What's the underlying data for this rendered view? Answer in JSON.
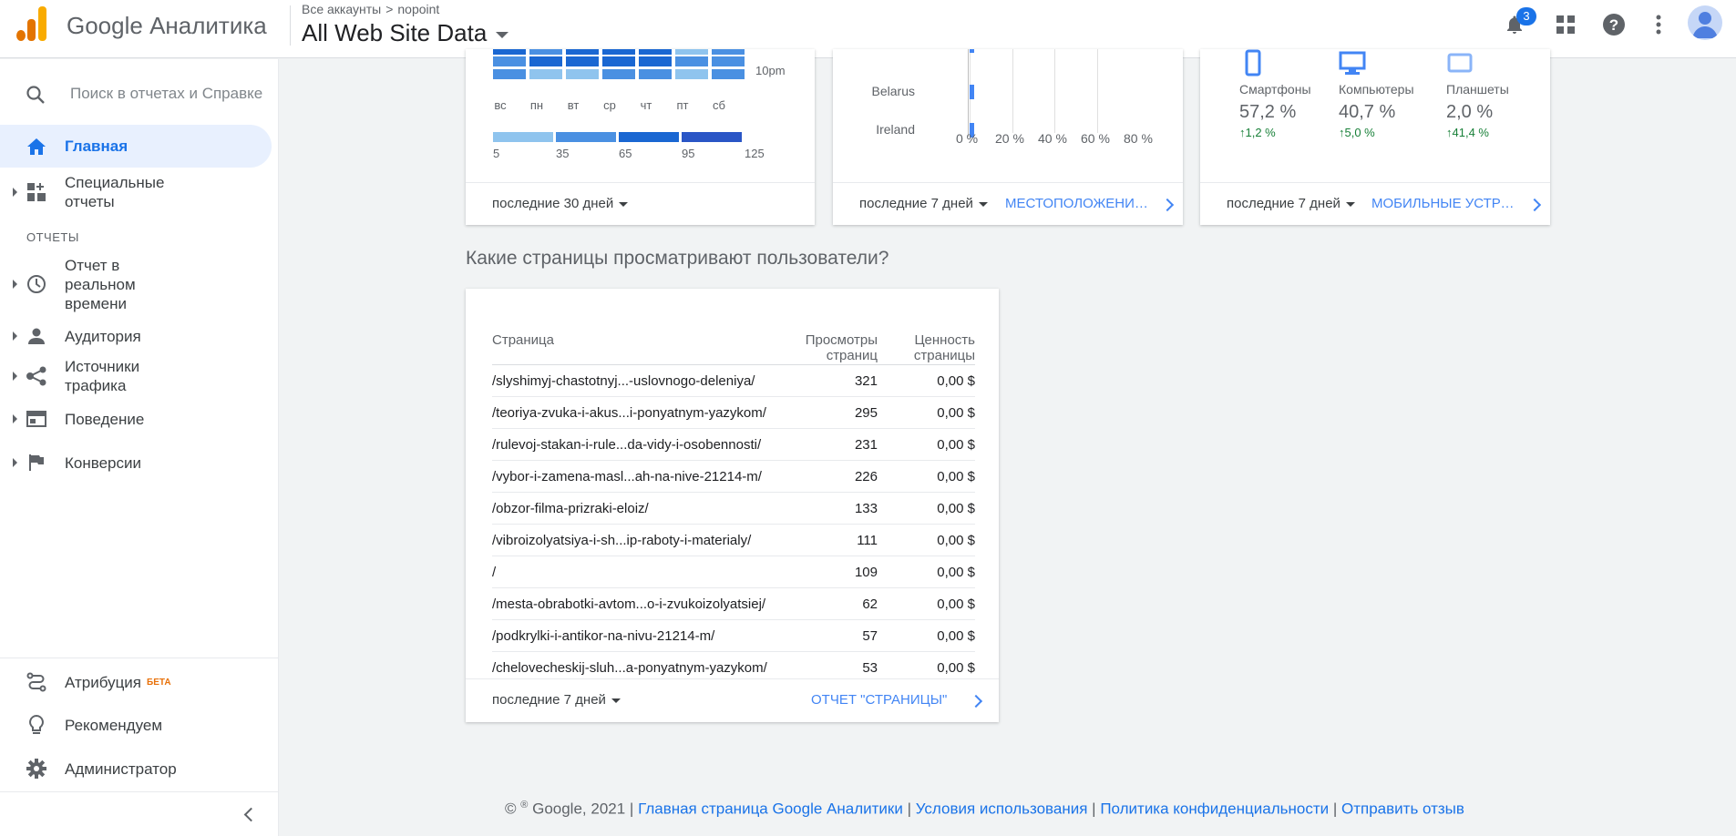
{
  "header": {
    "app_name": "Google Аналитика",
    "breadcrumb_accounts": "Все аккаунты",
    "breadcrumb_sep": ">",
    "breadcrumb_account": "nopoint",
    "property": "All Web Site Data",
    "notification_count": "3",
    "icons": [
      "bell-icon",
      "apps-icon",
      "help-icon",
      "more-vert-icon",
      "avatar"
    ]
  },
  "sidebar": {
    "search_placeholder": "Поиск в отчетах и Справке",
    "home": "Главная",
    "custom_reports_1": "Специальные",
    "custom_reports_2": "отчеты",
    "section_reports": "ОТЧЕТЫ",
    "realtime_1": "Отчет в",
    "realtime_2": "реальном",
    "realtime_3": "времени",
    "audience": "Аудитория",
    "acquisition_1": "Источники",
    "acquisition_2": "трафика",
    "behavior": "Поведение",
    "conversions": "Конверсии",
    "attribution": "Атрибуция",
    "attribution_badge": "БЕТА",
    "discover": "Рекомендуем",
    "admin": "Администратор"
  },
  "heatmap_card": {
    "time_label": "10pm",
    "days": [
      "вс",
      "пн",
      "вт",
      "ср",
      "чт",
      "пт",
      "сб"
    ],
    "legend": [
      "5",
      "35",
      "65",
      "95",
      "125"
    ],
    "footer_period": "последние 30 дней"
  },
  "geo_card": {
    "countries": [
      "Belarus",
      "Ireland"
    ],
    "ticks": [
      "0 %",
      "20 %",
      "40 %",
      "60 %",
      "80 %"
    ],
    "footer_period": "последние 7 дней",
    "footer_link": "МЕСТОПОЛОЖЕНИЕ ПОЛЬЗОВАТЕЛЕЙ"
  },
  "devices_card": {
    "devices": [
      {
        "name": "Смартфоны",
        "value": "57,2 %",
        "change": "1,2 %",
        "icon": "smartphone-icon"
      },
      {
        "name": "Компьютеры",
        "value": "40,7 %",
        "change": "5,0 %",
        "icon": "desktop-icon"
      },
      {
        "name": "Планшеты",
        "value": "2,0 %",
        "change": "41,4 %",
        "icon": "tablet-icon"
      }
    ],
    "footer_period": "последние 7 дней",
    "footer_link": "МОБИЛЬНЫЕ УСТРОЙСТВА"
  },
  "pages_section": {
    "title": "Какие страницы просматривают пользователи?",
    "col_page": "Страница",
    "col_views_1": "Просмотры",
    "col_views_2": "страниц",
    "col_value_1": "Ценность",
    "col_value_2": "страницы",
    "rows": [
      {
        "page": "/slyshimyj-chastotnyj...-uslovnogo-deleniya/",
        "views": "321",
        "value": "0,00 $"
      },
      {
        "page": "/teoriya-zvuka-i-akus...i-ponyatnym-yazykom/",
        "views": "295",
        "value": "0,00 $"
      },
      {
        "page": "/rulevoj-stakan-i-rule...da-vidy-i-osobennosti/",
        "views": "231",
        "value": "0,00 $"
      },
      {
        "page": "/vybor-i-zamena-masl...ah-na-nive-21214-m/",
        "views": "226",
        "value": "0,00 $"
      },
      {
        "page": "/obzor-filma-prizraki-eloiz/",
        "views": "133",
        "value": "0,00 $"
      },
      {
        "page": "/vibroizolyatsiya-i-sh...ip-raboty-i-materialy/",
        "views": "111",
        "value": "0,00 $"
      },
      {
        "page": "/",
        "views": "109",
        "value": "0,00 $"
      },
      {
        "page": "/mesta-obrabotki-avtom...o-i-zvukoizolyatsiej/",
        "views": "62",
        "value": "0,00 $"
      },
      {
        "page": "/podkrylki-i-antikor-na-nivu-21214-m/",
        "views": "57",
        "value": "0,00 $"
      },
      {
        "page": "/chelovecheskij-sluh...a-ponyatnym-yazykom/",
        "views": "53",
        "value": "0,00 $"
      }
    ],
    "footer_period": "последние 7 дней",
    "footer_link": "ОТЧЕТ \"СТРАНИЦЫ\""
  },
  "footer": {
    "copyright": "© ",
    "copyright_g": "Google, 2021 |",
    "link_home": "Главная страница Google Аналитики",
    "sep": "|",
    "link_terms": "Условия использования",
    "link_privacy": "Политика конфиденциальности",
    "link_feedback": "Отправить отзыв"
  }
}
